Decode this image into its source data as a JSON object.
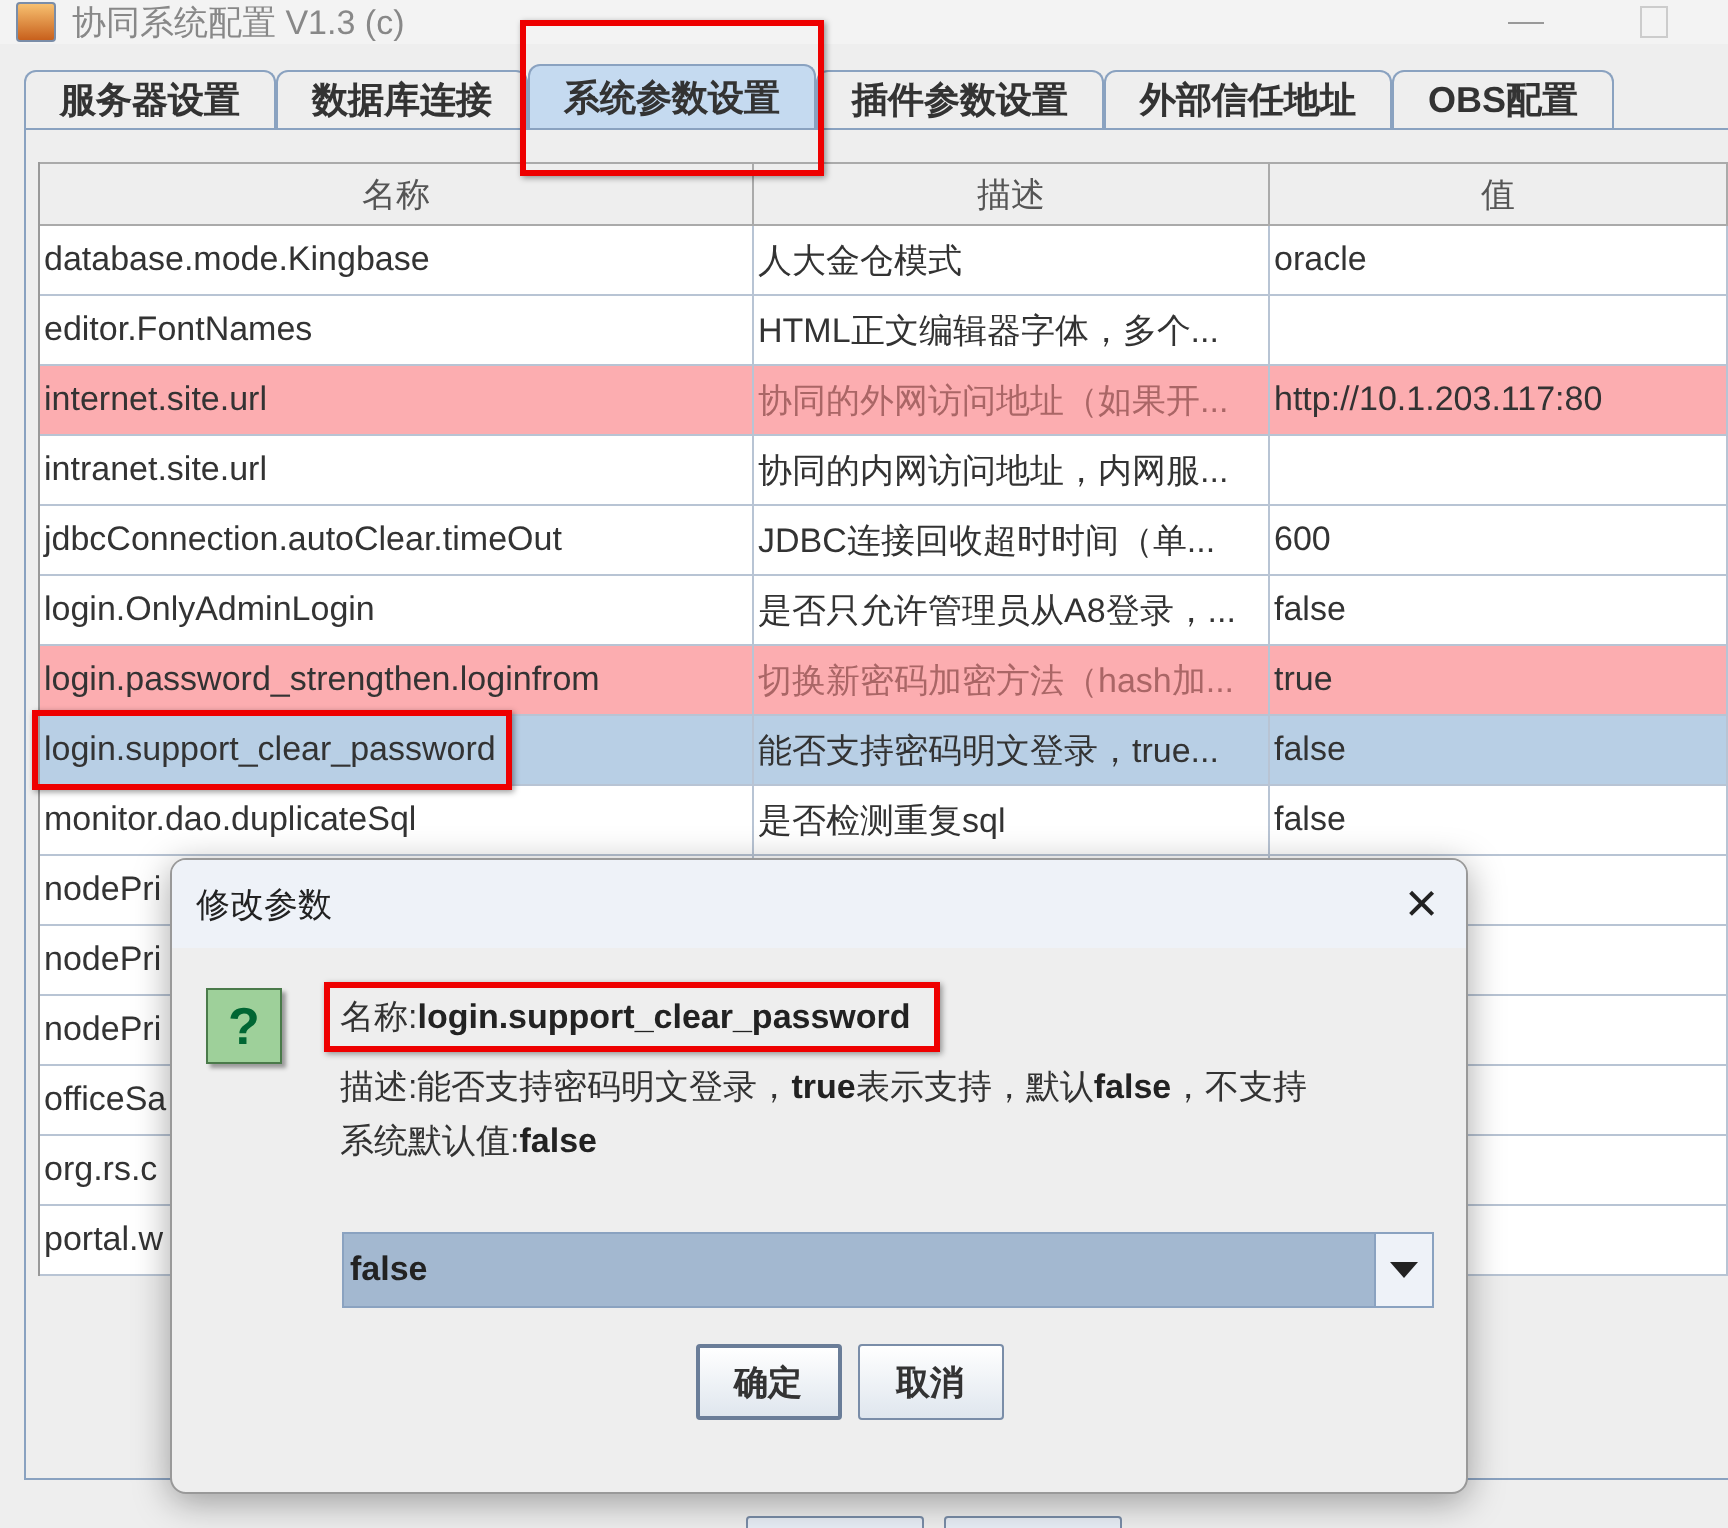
{
  "window": {
    "title": "协同系统配置 V1.3 (c)"
  },
  "tabs": [
    {
      "label": "服务器设置",
      "selected": false
    },
    {
      "label": "数据库连接",
      "selected": false
    },
    {
      "label": "系统参数设置",
      "selected": true
    },
    {
      "label": "插件参数设置",
      "selected": false
    },
    {
      "label": "外部信任地址",
      "selected": false
    },
    {
      "label": "OBS配置",
      "selected": false
    }
  ],
  "table": {
    "columns": [
      "名称",
      "描述",
      "值"
    ],
    "rows": [
      {
        "cells": [
          "database.mode.Kingbase",
          "人大金仓模式",
          "oracle"
        ],
        "flagged": false,
        "selected": false
      },
      {
        "cells": [
          "editor.FontNames",
          "HTML正文编辑器字体，多个...",
          ""
        ],
        "flagged": false,
        "selected": false
      },
      {
        "cells": [
          "internet.site.url",
          "协同的外网访问地址（如果开...",
          "http://10.1.203.117:80"
        ],
        "flagged": true,
        "selected": false
      },
      {
        "cells": [
          "intranet.site.url",
          "协同的内网访问地址，内网服...",
          ""
        ],
        "flagged": false,
        "selected": false
      },
      {
        "cells": [
          "jdbcConnection.autoClear.timeOut",
          "JDBC连接回收超时时间（单...",
          "600"
        ],
        "flagged": false,
        "selected": false
      },
      {
        "cells": [
          "login.OnlyAdminLogin",
          "是否只允许管理员从A8登录，...",
          "false"
        ],
        "flagged": false,
        "selected": false
      },
      {
        "cells": [
          "login.password_strengthen.loginfrom",
          "切换新密码加密方法（hash加...",
          "true"
        ],
        "flagged": true,
        "selected": false
      },
      {
        "cells": [
          "login.support_clear_password",
          "能否支持密码明文登录，true...",
          "false"
        ],
        "flagged": false,
        "selected": true
      },
      {
        "cells": [
          "monitor.dao.duplicateSql",
          "是否检测重复sql",
          "false"
        ],
        "flagged": false,
        "selected": false
      },
      {
        "cells": [
          "nodePri",
          "",
          ""
        ],
        "flagged": false,
        "selected": false
      },
      {
        "cells": [
          "nodePri",
          "",
          ""
        ],
        "flagged": false,
        "selected": false
      },
      {
        "cells": [
          "nodePri",
          "",
          ""
        ],
        "flagged": false,
        "selected": false
      },
      {
        "cells": [
          "officeSa",
          "",
          ""
        ],
        "flagged": false,
        "selected": false
      },
      {
        "cells": [
          "org.rs.c",
          "",
          ""
        ],
        "flagged": false,
        "selected": false
      },
      {
        "cells": [
          "portal.w",
          "",
          ""
        ],
        "flagged": false,
        "selected": false
      }
    ]
  },
  "dialog": {
    "title": "修改参数",
    "close": "×",
    "lines": [
      "名称:**login.support_clear_password**",
      "描述:能否支持密码明文登录，**true**表示支持，默认**false**，不支持",
      "系统默认值:**false**"
    ],
    "icon_glyph": "?",
    "select": {
      "value": "false"
    },
    "buttons": [
      {
        "label": "确定",
        "default": true
      },
      {
        "label": "取消",
        "default": false
      }
    ]
  }
}
